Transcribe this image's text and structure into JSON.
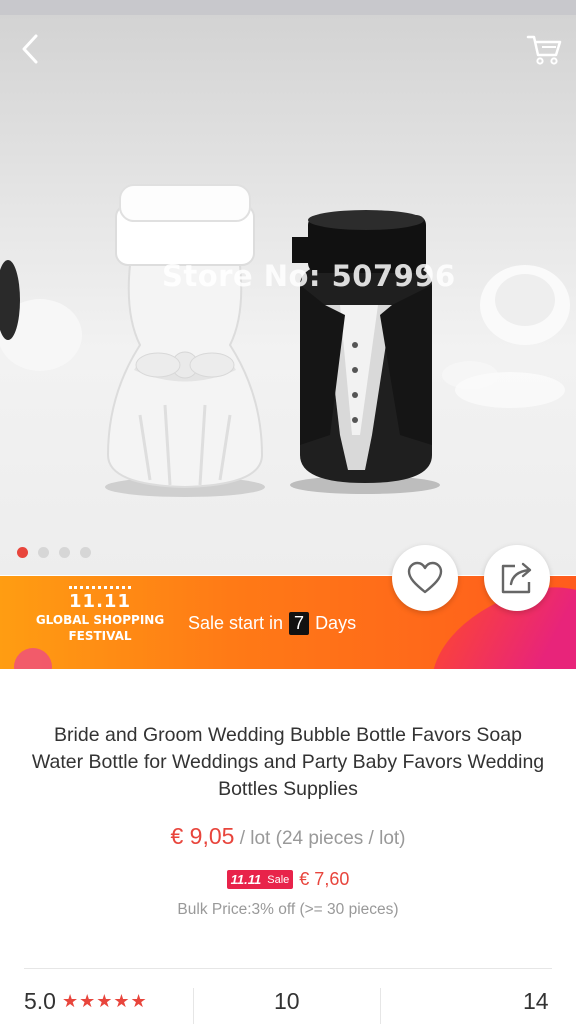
{
  "hero": {
    "watermark": "Store No: 507996",
    "dots_total": 4,
    "dot_active": 1
  },
  "nav": {
    "back_icon": "chevron-left-icon",
    "cart_icon": "cart-icon"
  },
  "banner": {
    "logo_text": "11.11",
    "line1": "GLOBAL SHOPPING",
    "line2": "FESTIVAL",
    "sale_prefix": "Sale start in",
    "countdown": "7",
    "sale_suffix": "Days"
  },
  "actions": {
    "favorite_icon": "heart-icon",
    "share_icon": "share-icon"
  },
  "product": {
    "title": "Bride and Groom Wedding Bubble Bottle Favors Soap Water Bottle for Weddings and Party Baby Favors Wedding Bottles Supplies",
    "price": "€ 9,05",
    "price_unit": " / lot (24 pieces / lot)",
    "sale_badge_logo": "11.11",
    "sale_badge_text": "Sale",
    "sale_price": "€ 7,60",
    "bulk": "Bulk Price:3% off (>= 30 pieces)"
  },
  "stats": {
    "rating": "5.0",
    "stars": "★★★★★",
    "rating_value": 5.0,
    "middle": "10",
    "right": "14"
  },
  "colors": {
    "accent": "#e8453c",
    "banner_orange": "#ff7a16",
    "sale_badge": "#e8234a"
  }
}
